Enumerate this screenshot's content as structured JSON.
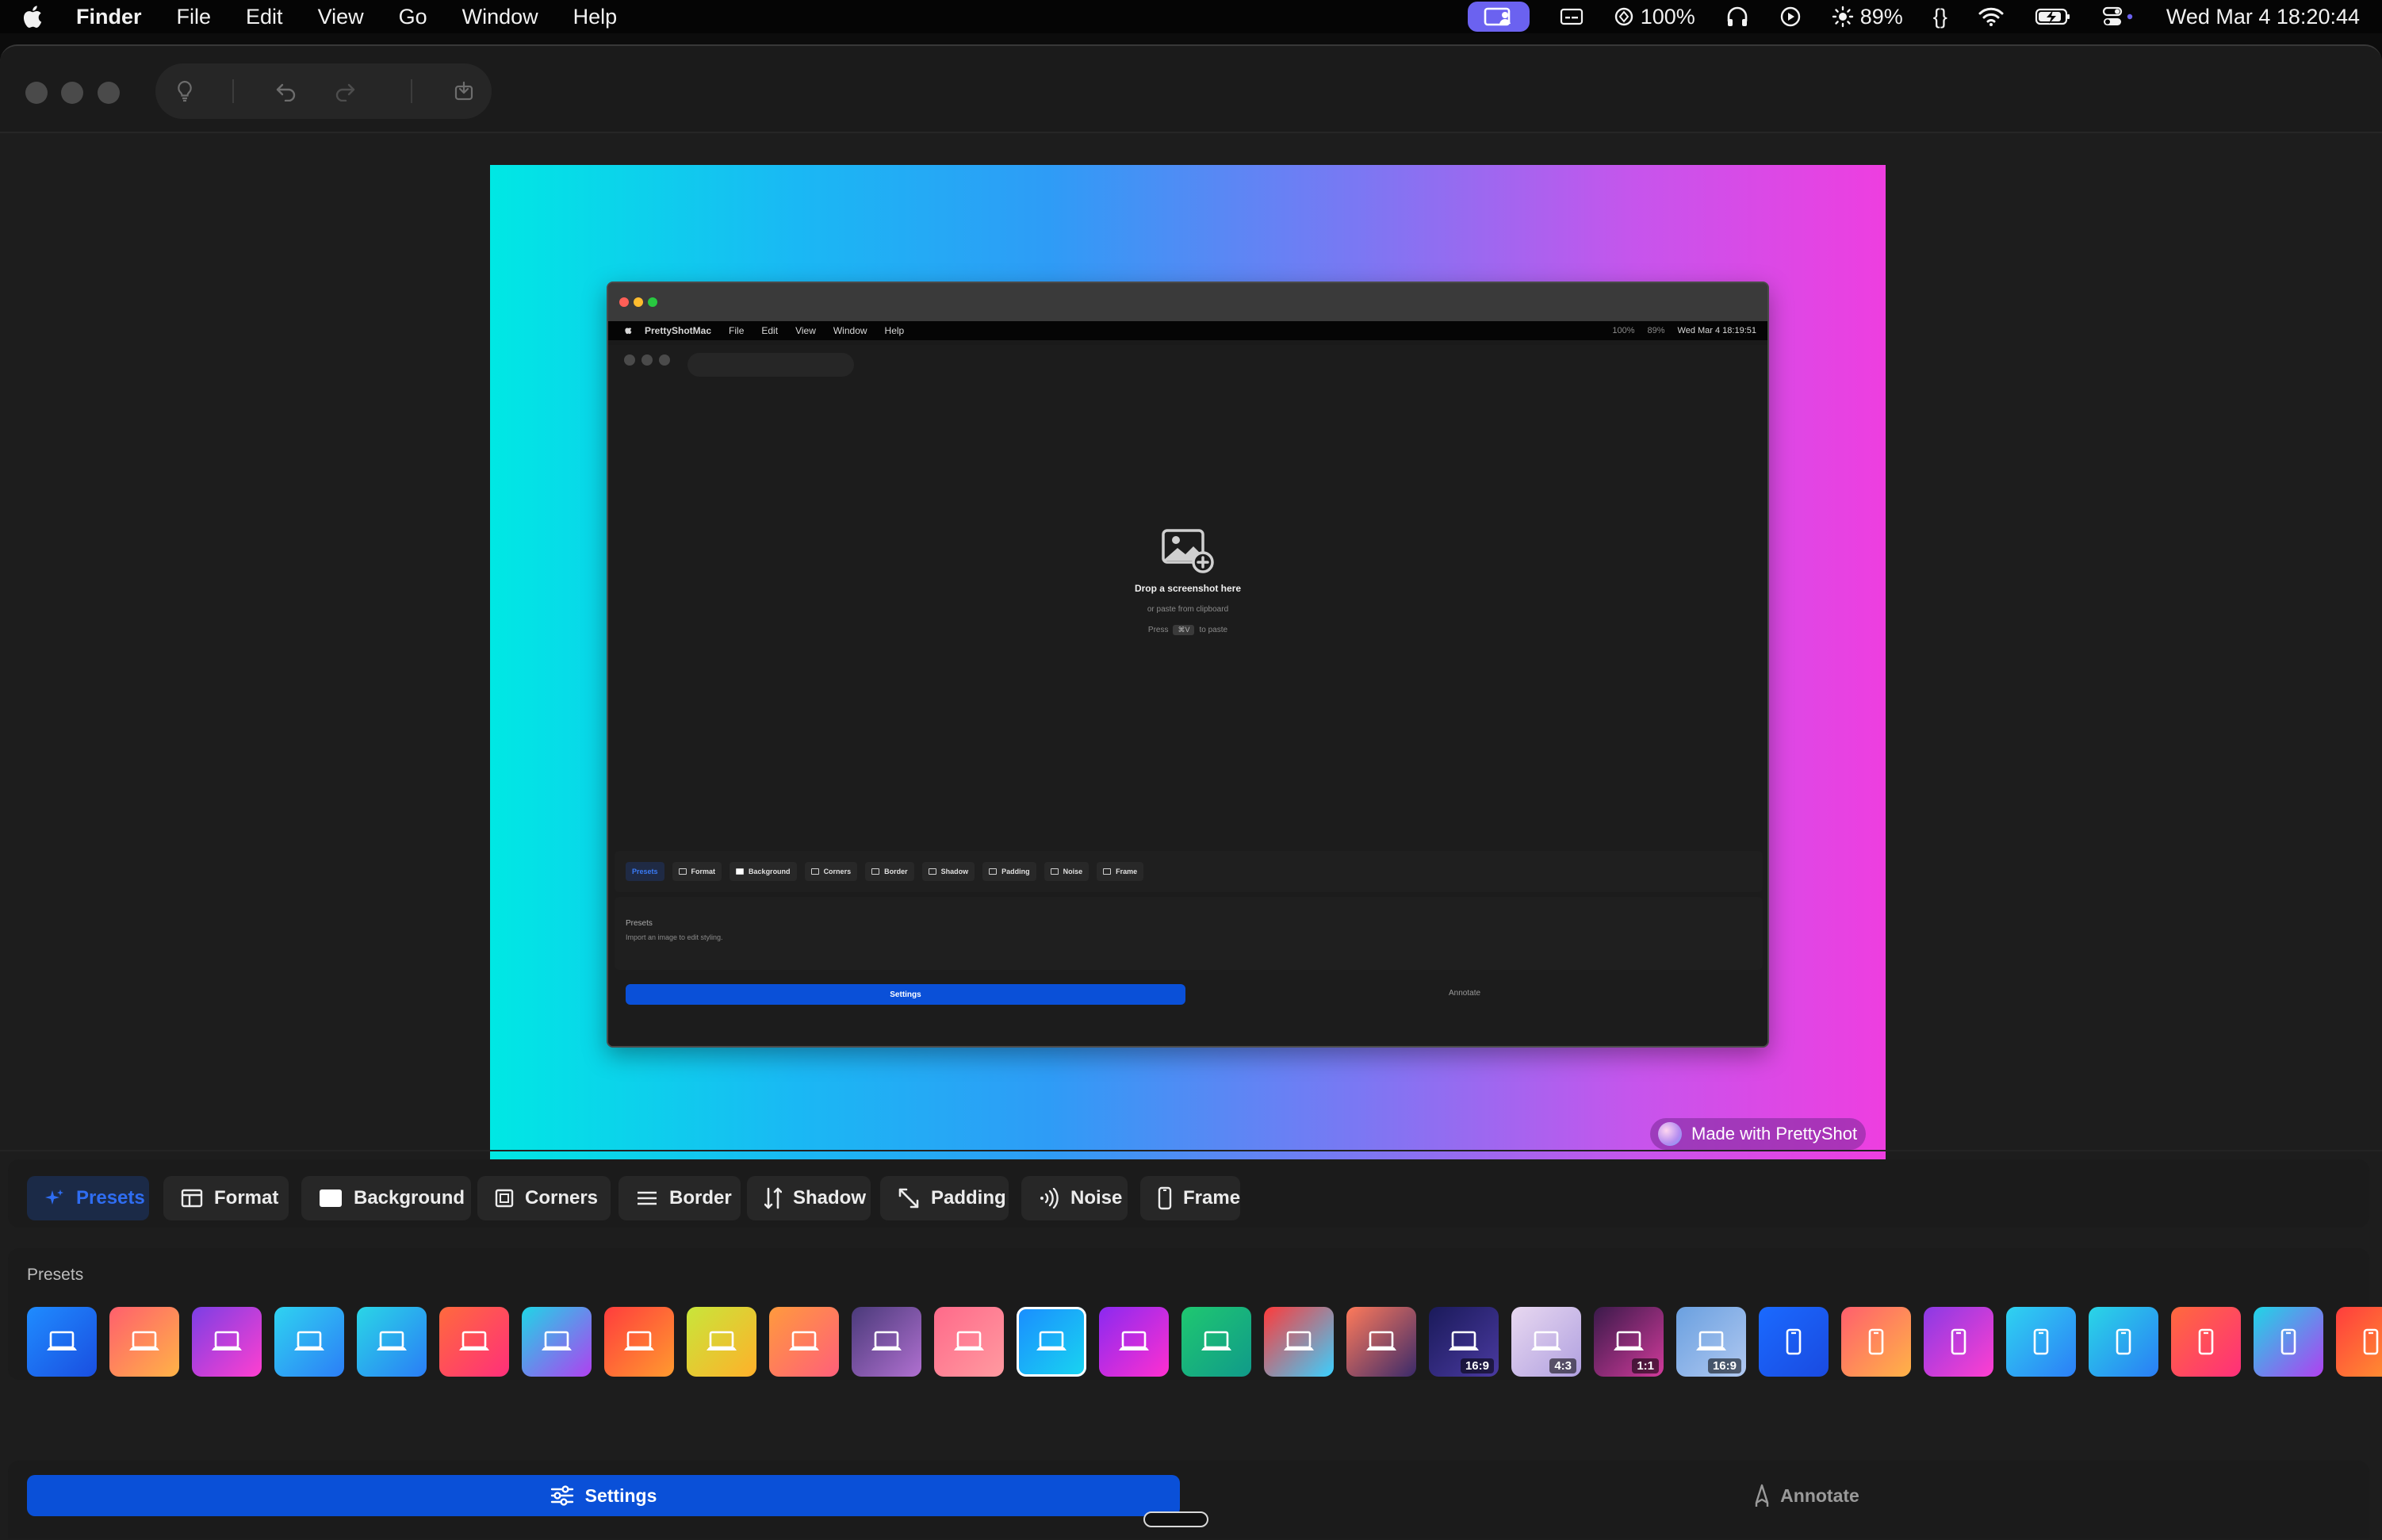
{
  "menubar": {
    "app_name": "Finder",
    "menu_items": [
      "File",
      "Edit",
      "View",
      "Go",
      "Window",
      "Help"
    ],
    "status": {
      "cpu": "100%",
      "brightness": "89%",
      "braces": "{}",
      "datetime": "Wed Mar 4  18:20:44"
    },
    "status_icons": [
      "screen-share-icon",
      "captions-icon",
      "chatgpt-icon",
      "headphones-icon",
      "play-circle-icon",
      "brightness-icon",
      "braces-icon",
      "wifi-icon",
      "battery-icon",
      "control-center-icon"
    ],
    "accent_color": "#6b62f0"
  },
  "window": {
    "toolbar_icons": [
      "lightbulb-icon",
      "undo-icon",
      "redo-icon",
      "save-icon"
    ]
  },
  "preview": {
    "gradient": [
      "#00e8e4",
      "#2e9cf6",
      "#7a78f3",
      "#ee3ee0"
    ],
    "inner_menubar": {
      "app_name": "PrettyShotMac",
      "menu_items": [
        "File",
        "Edit",
        "View",
        "Window",
        "Help"
      ],
      "cpu": "100%",
      "brightness": "89%",
      "datetime": "Wed Mar 4  18:19:51"
    },
    "drop": {
      "title": "Drop a screenshot here",
      "subtitle": "or paste from clipboard",
      "press": "Press",
      "key": "⌘V",
      "to_paste": "to paste"
    },
    "inner_tabs": [
      "Presets",
      "Format",
      "Background",
      "Corners",
      "Border",
      "Shadow",
      "Padding",
      "Noise",
      "Frame"
    ],
    "inner_presets_title": "Presets",
    "inner_presets_desc": "Import an image to edit styling.",
    "inner_settings": "Settings",
    "inner_annotate": "Annotate",
    "watermark": "Made with PrettyShot"
  },
  "tabs": {
    "presets": "Presets",
    "format": "Format",
    "background": "Background",
    "corners": "Corners",
    "border": "Border",
    "shadow": "Shadow",
    "padding": "Padding",
    "noise": "Noise",
    "frame": "Frame",
    "active_color": "#2f6df2"
  },
  "presets": {
    "title": "Presets",
    "items": [
      {
        "icon": "laptop-icon",
        "colors": [
          "#1f8cff",
          "#1a4ee0"
        ],
        "ratio": ""
      },
      {
        "icon": "laptop-icon",
        "colors": [
          "#ff5f6d",
          "#ffb347"
        ],
        "ratio": ""
      },
      {
        "icon": "laptop-icon",
        "colors": [
          "#7b3fe4",
          "#ff3fd0"
        ],
        "ratio": ""
      },
      {
        "icon": "laptop-icon",
        "colors": [
          "#2fd3f0",
          "#2c7ef7"
        ],
        "ratio": ""
      },
      {
        "icon": "laptop-icon",
        "colors": [
          "#2ad6e6",
          "#2a7df6"
        ],
        "ratio": ""
      },
      {
        "icon": "laptop-icon",
        "colors": [
          "#ff6a3d",
          "#ff2f7a"
        ],
        "ratio": ""
      },
      {
        "icon": "laptop-icon",
        "colors": [
          "#1fd6e6",
          "#b040f0"
        ],
        "ratio": ""
      },
      {
        "icon": "laptop-icon",
        "colors": [
          "#ff3d3d",
          "#ff9a2f"
        ],
        "ratio": ""
      },
      {
        "icon": "laptop-icon",
        "colors": [
          "#c8e63a",
          "#ffb02a"
        ],
        "ratio": ""
      },
      {
        "icon": "laptop-icon",
        "colors": [
          "#ff9a3d",
          "#ff5f7a"
        ],
        "ratio": ""
      },
      {
        "icon": "laptop-icon",
        "colors": [
          "#4a3a7a",
          "#b070d0"
        ],
        "ratio": ""
      },
      {
        "icon": "laptop-icon",
        "colors": [
          "#ff6a8a",
          "#ff9aa0"
        ],
        "ratio": ""
      },
      {
        "icon": "laptop-icon",
        "colors": [
          "#1a8cff",
          "#19d6f0"
        ],
        "ratio": ""
      },
      {
        "icon": "laptop-icon",
        "colors": [
          "#8a2af0",
          "#ff2fd0"
        ],
        "ratio": ""
      },
      {
        "icon": "laptop-icon",
        "colors": [
          "#1fc870",
          "#109a8a"
        ],
        "ratio": ""
      },
      {
        "icon": "laptop-icon",
        "colors": [
          "#ff3a3a",
          "#3ad0ff"
        ],
        "ratio": ""
      },
      {
        "icon": "laptop-icon",
        "colors": [
          "#ff7a5a",
          "#3a2a6a"
        ],
        "ratio": ""
      },
      {
        "icon": "laptop-icon",
        "colors": [
          "#1a1a5a",
          "#4a3aa0"
        ],
        "ratio": "16:9"
      },
      {
        "icon": "laptop-icon",
        "colors": [
          "#e8d8f0",
          "#b0a0e0"
        ],
        "ratio": "4:3"
      },
      {
        "icon": "laptop-icon",
        "colors": [
          "#3a1a4a",
          "#d03a9a"
        ],
        "ratio": "1:1"
      },
      {
        "icon": "laptop-icon",
        "colors": [
          "#6aa0e0",
          "#b0c8f0"
        ],
        "ratio": "16:9"
      },
      {
        "icon": "phone-icon",
        "colors": [
          "#1a6aff",
          "#1a4ae0"
        ],
        "ratio": ""
      },
      {
        "icon": "phone-icon",
        "colors": [
          "#ff5f6d",
          "#ffb347"
        ],
        "ratio": ""
      },
      {
        "icon": "phone-icon",
        "colors": [
          "#8a3ae4",
          "#ff3fd0"
        ],
        "ratio": ""
      },
      {
        "icon": "phone-icon",
        "colors": [
          "#2fd3f0",
          "#2c7ef7"
        ],
        "ratio": ""
      },
      {
        "icon": "phone-icon",
        "colors": [
          "#2ad6e6",
          "#2a7df6"
        ],
        "ratio": ""
      },
      {
        "icon": "phone-icon",
        "colors": [
          "#ff6a3d",
          "#ff2f7a"
        ],
        "ratio": ""
      },
      {
        "icon": "phone-icon",
        "colors": [
          "#1fd6e6",
          "#b040f0"
        ],
        "ratio": ""
      },
      {
        "icon": "phone-icon",
        "colors": [
          "#ff3d3d",
          "#ff9a2f"
        ],
        "ratio": ""
      }
    ]
  },
  "bottom": {
    "settings": "Settings",
    "annotate": "Annotate",
    "settings_color": "#0a50d8"
  }
}
